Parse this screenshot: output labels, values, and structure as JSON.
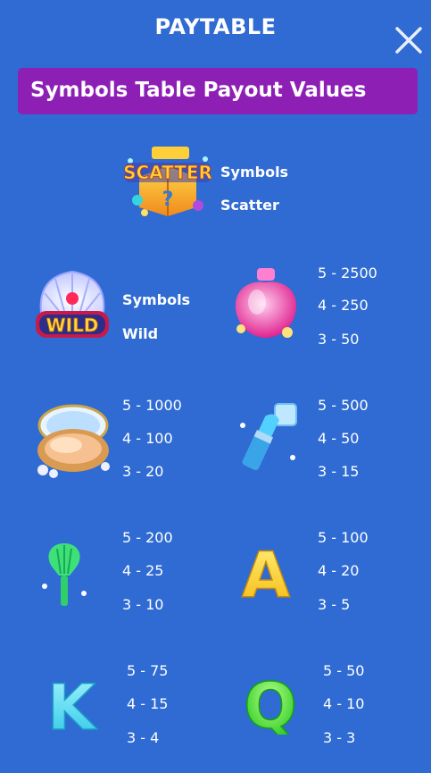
{
  "header": {
    "title": "PAYTABLE"
  },
  "close_icon": "close-icon",
  "banner": {
    "text": "Symbols Table Payout Values"
  },
  "scatter": {
    "icon": "scatter-chest-icon",
    "logo_text": "SCATTER",
    "label1": "Symbols",
    "label2": "Scatter"
  },
  "wild": {
    "icon": "wild-shell-crown-icon",
    "logo_text": "WILD",
    "label1": "Symbols",
    "label2": "Wild"
  },
  "symbols": [
    {
      "icon": "perfume-bottle-icon",
      "pays": [
        "5 - 2500",
        "4 - 250",
        "3 - 50"
      ]
    },
    {
      "icon": "makeup-compact-icon",
      "pays": [
        "5 - 1000",
        "4 - 100",
        "3 - 20"
      ]
    },
    {
      "icon": "lipstick-icon",
      "pays": [
        "5 - 500",
        "4 - 50",
        "3 - 15"
      ]
    },
    {
      "icon": "makeup-brush-icon",
      "pays": [
        "5 - 200",
        "4 - 25",
        "3 - 10"
      ]
    },
    {
      "icon": "letter-a-icon",
      "letter": "A",
      "pays": [
        "5 - 100",
        "4 - 20",
        "3 - 5"
      ]
    },
    {
      "icon": "letter-k-icon",
      "letter": "K",
      "pays": [
        "5 - 75",
        "4 - 15",
        "3 - 4"
      ]
    },
    {
      "icon": "letter-q-icon",
      "letter": "Q",
      "pays": [
        "5 - 50",
        "4 - 10",
        "3 - 3"
      ]
    }
  ],
  "colors": {
    "background": "#2f6bd3",
    "banner": "#8e1fb5",
    "text": "#ffffff"
  }
}
